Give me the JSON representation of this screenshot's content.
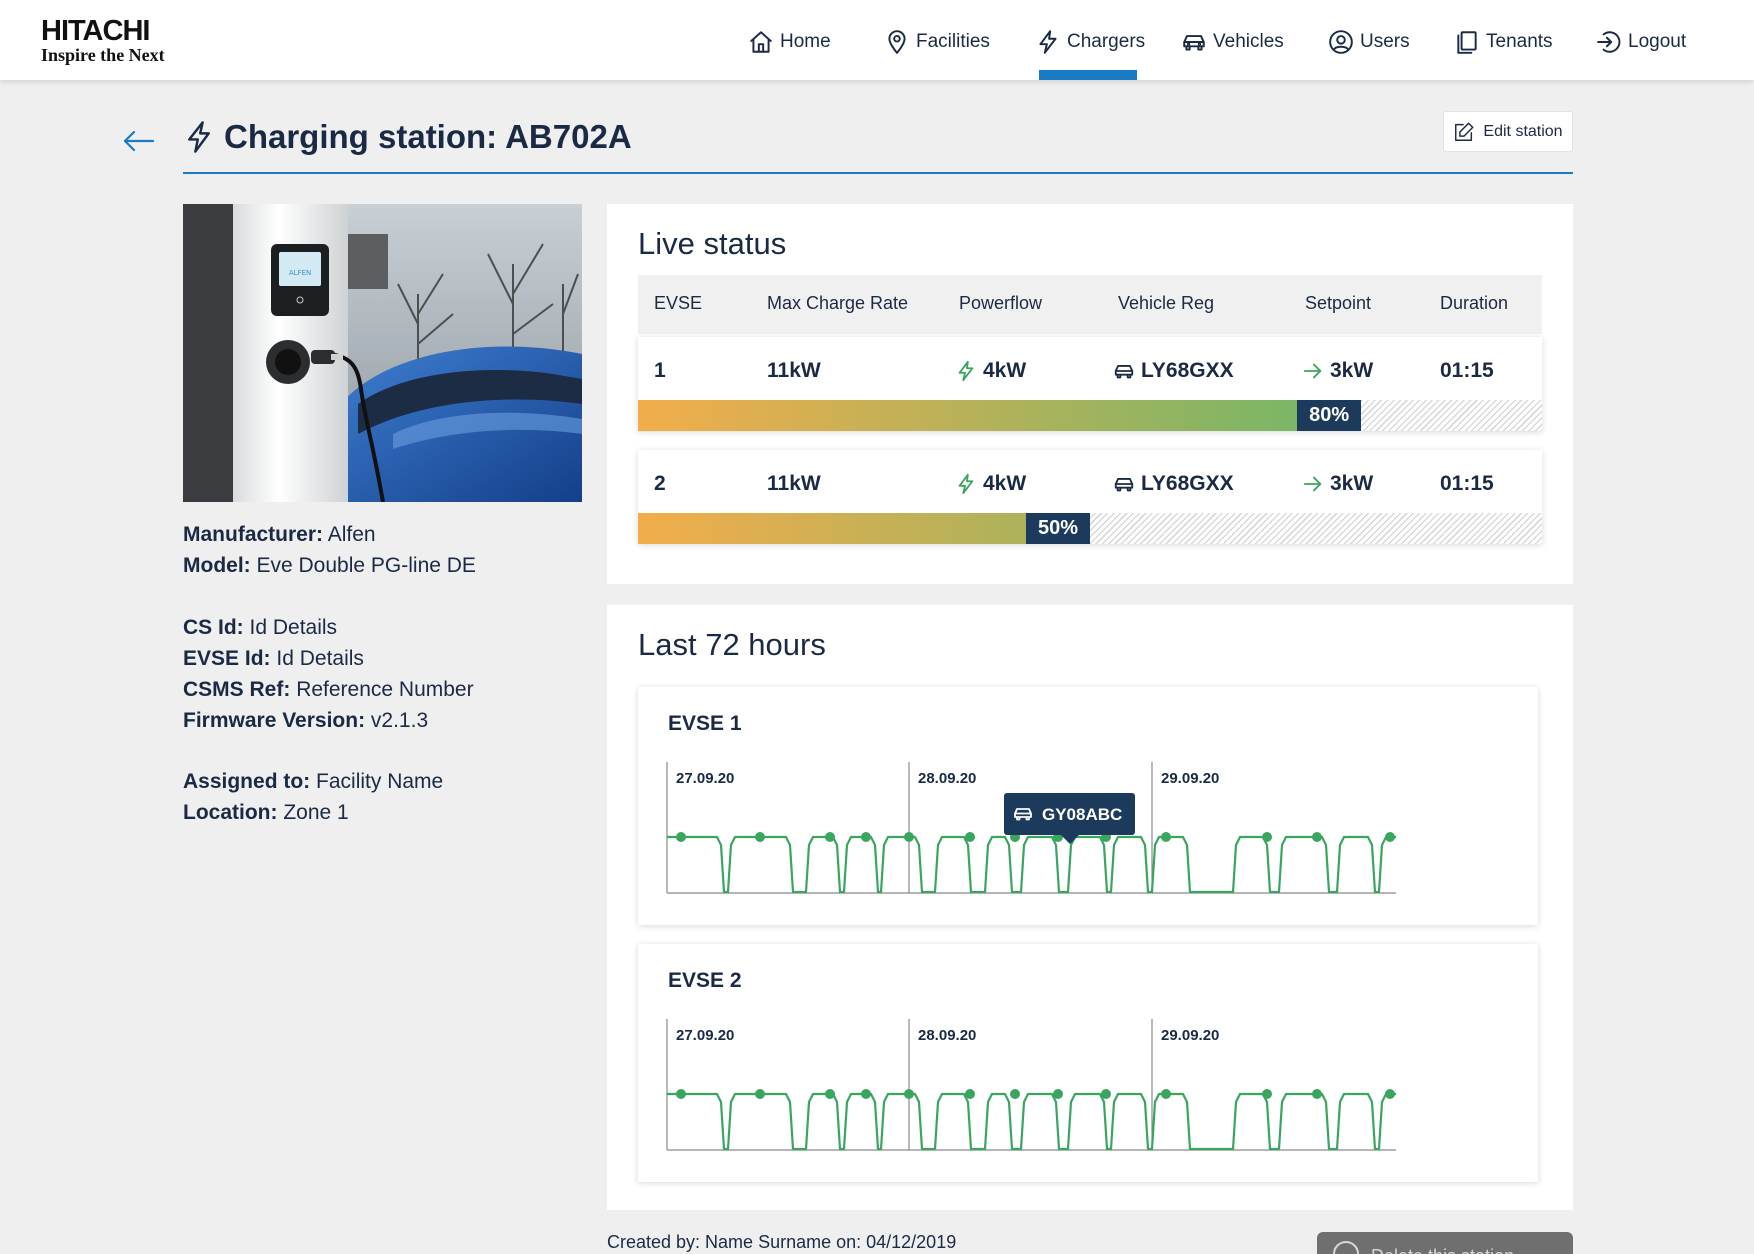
{
  "brand": {
    "name": "HITACHI",
    "tagline": "Inspire the Next"
  },
  "nav": {
    "items": [
      {
        "label": "Home",
        "icon": "home-icon"
      },
      {
        "label": "Facilities",
        "icon": "map-pin-icon"
      },
      {
        "label": "Chargers",
        "icon": "lightning-icon",
        "active": true
      },
      {
        "label": "Vehicles",
        "icon": "car-icon"
      },
      {
        "label": "Users",
        "icon": "user-circle-icon"
      },
      {
        "label": "Tenants",
        "icon": "copy-icon"
      },
      {
        "label": "Logout",
        "icon": "logout-icon"
      }
    ],
    "active_color": "#1a7ac4"
  },
  "header": {
    "title": "Charging station: AB702A",
    "edit_label": "Edit station"
  },
  "station": {
    "manufacturer_label": "Manufacturer:",
    "manufacturer": "Alfen",
    "model_label": "Model:",
    "model": "Eve Double PG-line DE",
    "cs_id_label": "CS Id:",
    "cs_id": "Id Details",
    "evse_id_label": "EVSE Id:",
    "evse_id": "Id Details",
    "csms_ref_label": "CSMS Ref:",
    "csms_ref": "Reference Number",
    "firmware_label": "Firmware Version:",
    "firmware": "v2.1.3",
    "assigned_label": "Assigned to:",
    "assigned": "Facility Name",
    "location_label": "Location:",
    "location": "Zone 1",
    "photo_brand": "ALFEN"
  },
  "live_status": {
    "title": "Live status",
    "columns": [
      "EVSE",
      "Max Charge Rate",
      "Powerflow",
      "Vehicle Reg",
      "Setpoint",
      "Duration"
    ],
    "rows": [
      {
        "evse": "1",
        "max_rate": "11kW",
        "powerflow": "4kW",
        "vehicle_reg": "LY68GXX",
        "setpoint": "3kW",
        "duration": "01:15",
        "charge_percent": 80,
        "charge_label": "80%"
      },
      {
        "evse": "2",
        "max_rate": "11kW",
        "powerflow": "4kW",
        "vehicle_reg": "LY68GXX",
        "setpoint": "3kW",
        "duration": "01:15",
        "charge_percent": 50,
        "charge_label": "50%"
      }
    ],
    "colors": {
      "bar_start": "#f3ad4b",
      "bar_end": "#6db76a",
      "label_bg": "#1b3a5c",
      "powerflow_icon": "#3aa55e",
      "setpoint_icon": "#3aa55e"
    }
  },
  "last72": {
    "title": "Last 72 hours",
    "charts": [
      {
        "title": "EVSE 1",
        "days": [
          "27.09.20",
          "28.09.20",
          "29.09.20"
        ],
        "tooltip": "GY08ABC"
      },
      {
        "title": "EVSE 2",
        "days": [
          "27.09.20",
          "28.09.20",
          "29.09.20"
        ],
        "tooltip": ""
      }
    ],
    "line_color": "#3aa55e"
  },
  "footer": {
    "created_by": "Created by: Name Surname on: 04/12/2019",
    "delete_label": "Delete this station"
  }
}
